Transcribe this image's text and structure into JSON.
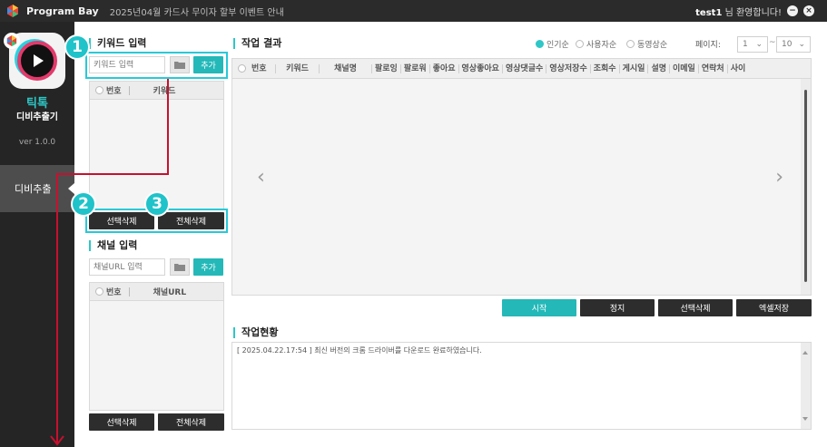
{
  "titlebar": {
    "app_name": "Program Bay",
    "notice": "2025년04월 카드사 무이자 할부 이벤트 안내",
    "user": "test1",
    "welcome": " 님 환영합니다!",
    "minimize_icon": "minimize-icon",
    "close_icon": "close-icon"
  },
  "sidebar": {
    "app_title": "틱톡",
    "app_subtitle": "디비추출기",
    "version": "ver 1.0.0",
    "menu_active": "디비추출"
  },
  "keyword": {
    "title": "키워드 입력",
    "input_placeholder": "키워드 입력",
    "add_label": "추가",
    "col_no": "번호",
    "col_keyword": "키워드",
    "delete_selected": "선택삭제",
    "delete_all": "전체삭제"
  },
  "channel": {
    "title": "채널 입력",
    "input_placeholder": "채널URL 입력",
    "add_label": "추가",
    "col_no": "번호",
    "col_url": "채널URL",
    "delete_selected": "선택삭제",
    "delete_all": "전체삭제"
  },
  "result": {
    "title": "작업 결과",
    "sort_options": [
      "인기순",
      "사용자순",
      "동영상순"
    ],
    "sort_selected": "인기순",
    "page_label": "페이지:",
    "page_from": "1",
    "page_to": "10",
    "columns": [
      "번호",
      "키워드",
      "채널명",
      "팔로잉",
      "팔로워",
      "좋아요",
      "영상좋아요",
      "영상댓글수",
      "영상저장수",
      "조회수",
      "게시일",
      "설명",
      "이메일",
      "연락처",
      "사이"
    ],
    "buttons": {
      "start": "시작",
      "stop": "정지",
      "delete_selected": "선택삭제",
      "excel_save": "엑셀저장"
    }
  },
  "status": {
    "title": "작업현황",
    "log": "[ 2025.04.22.17:54 ] 최신 버전의 크롬 드라이버를 다운로드 완료하였습니다."
  },
  "annotations": {
    "badge_1": "1",
    "badge_2": "2",
    "badge_3": "3"
  },
  "colors": {
    "accent": "#25b8b8",
    "dark": "#2d2d2d",
    "sidebar": "#252525",
    "annotation_line": "#c8102e"
  }
}
